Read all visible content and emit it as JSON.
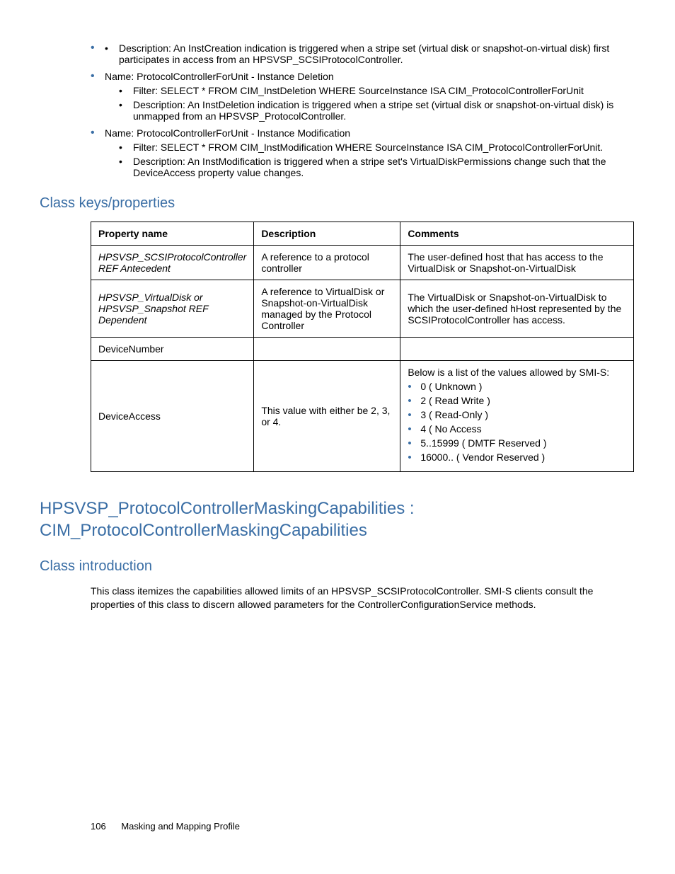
{
  "bullets": {
    "top_desc": "Description: An InstCreation indication is triggered when a stripe set (virtual disk or snapshot-on-virtual disk) first participates in access from an HPSVSP_SCSIProtocolController.",
    "item1_name": "Name: ProtocolControllerForUnit - Instance Deletion",
    "item1_filter": "Filter: SELECT * FROM CIM_InstDeletion WHERE SourceInstance ISA CIM_ProtocolControllerForUnit",
    "item1_desc": "Description: An InstDeletion indication is triggered when a stripe set (virtual disk or snapshot-on-virtual disk) is unmapped from an HPSVSP_ProtocolController.",
    "item2_name": "Name: ProtocolControllerForUnit - Instance Modification",
    "item2_filter": "Filter: SELECT * FROM CIM_InstModification WHERE SourceInstance ISA CIM_ProtocolControllerForUnit.",
    "item2_desc": "Description: An InstModification is triggered when a stripe set's VirtualDiskPermissions change such that the DeviceAccess property value changes."
  },
  "section1_title": "Class keys/properties",
  "table": {
    "headers": {
      "c1": "Property name",
      "c2": "Description",
      "c3": "Comments"
    },
    "row1": {
      "c1": "HPSVSP_SCSIProtocolController REF Antecedent",
      "c2": "A reference to a protocol controller",
      "c3": "The user-defined host that has access to the VirtualDisk or Snapshot-on-VirtualDisk"
    },
    "row2": {
      "c1": "HPSVSP_VirtualDisk or HPSVSP_Snapshot REF Dependent",
      "c2": "A reference to VirtualDisk or Snapshot-on-VirtualDisk managed by the Protocol Controller",
      "c3": "The VirtualDisk or Snapshot-on-VirtualDisk to which the user-defined hHost represented by the SCSIProtocolController has access."
    },
    "row3": {
      "c1": "DeviceNumber",
      "c2": "",
      "c3": ""
    },
    "row4": {
      "c1": "DeviceAccess",
      "c2": "This value with either be 2, 3, or 4.",
      "c3_intro": "Below is a list of the values allowed by SMI-S:",
      "c3_list": {
        "i0": "0 ( Unknown )",
        "i1": "2 ( Read Write )",
        "i2": "3 ( Read-Only )",
        "i3": "4 ( No Access",
        "i4": "5..15999 ( DMTF Reserved )",
        "i5": "16000.. ( Vendor Reserved )"
      }
    }
  },
  "section2_title": "HPSVSP_ProtocolControllerMaskingCapabilities : CIM_ProtocolControllerMaskingCapabilities",
  "section2_sub_title": "Class introduction",
  "section2_body": "This class itemizes the capabilities allowed limits of an HPSVSP_SCSIProtocolController. SMI-S clients consult the properties of this class to discern allowed parameters for the ControllerConfigurationService methods.",
  "footer": {
    "page": "106",
    "title": "Masking and Mapping Profile"
  }
}
